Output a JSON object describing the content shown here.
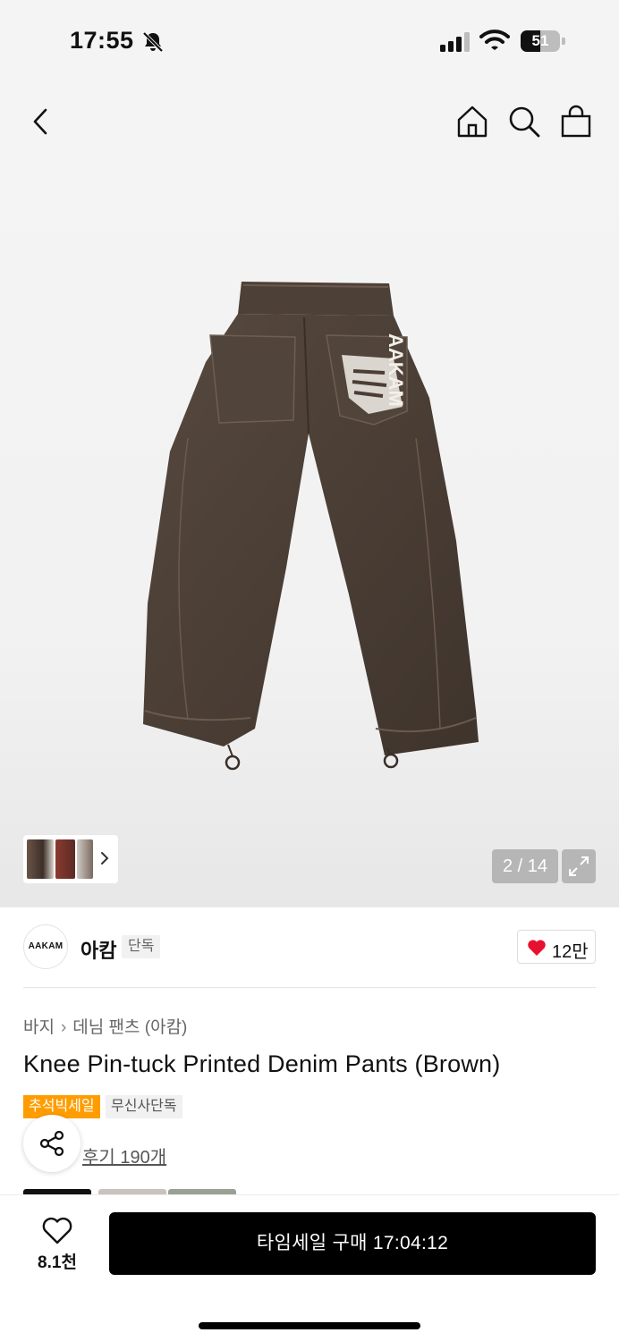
{
  "status_bar": {
    "time": "17:55",
    "battery_level": "51",
    "battery_fraction": 0.51
  },
  "gallery": {
    "image_name": "brown-denim-pants-back-view",
    "print_text": "AAKAM",
    "page_indicator": "2 / 14"
  },
  "brand": {
    "logo_text": "AAKAM",
    "name": "아캄",
    "badge": "단독",
    "likes": "12만",
    "heart_color": "#e8102f"
  },
  "breadcrumb": {
    "category": "바지",
    "subcategory": "데님 팬츠 (아캄)"
  },
  "product": {
    "title": "Knee Pin-tuck Printed Denim Pants (Brown)",
    "tags": {
      "sale": "추석빅세일",
      "exclusive": "무신사단독"
    },
    "sale_tag_color": "#ff9d00",
    "review_link": "후기 190개"
  },
  "bottom_bar": {
    "wish_count": "8.1천",
    "buy_button": "타임세일 구매 17:04:12"
  },
  "icons": [
    "bell-off-icon",
    "signal-icon",
    "wifi-icon",
    "battery-icon",
    "back-icon",
    "home-icon",
    "search-icon",
    "shopping-bag-icon",
    "chevron-right-icon",
    "fullscreen-icon",
    "heart-icon",
    "share-icon",
    "heart-outline-icon"
  ]
}
